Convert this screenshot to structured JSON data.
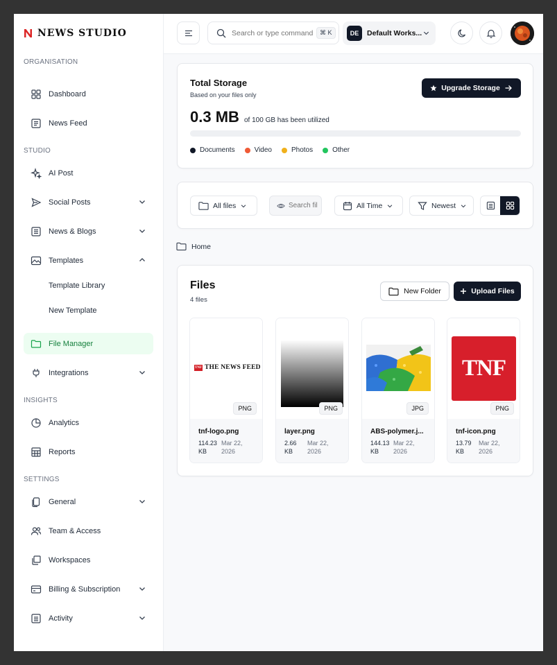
{
  "brand": {
    "name": "NEWS STUDIO",
    "accent": "#dc2626"
  },
  "sidebar": {
    "sections": {
      "organisation": "ORGANISATION",
      "studio": "STUDIO",
      "insights": "INSIGHTS",
      "settings": "SETTINGS"
    },
    "items": {
      "dashboard": "Dashboard",
      "news_feed": "News Feed",
      "ai_post": "AI Post",
      "social_posts": "Social Posts",
      "news_blogs": "News & Blogs",
      "templates": "Templates",
      "template_library": "Template Library",
      "new_template": "New Template",
      "file_manager": "File Manager",
      "integrations": "Integrations",
      "analytics": "Analytics",
      "reports": "Reports",
      "general": "General",
      "team_access": "Team & Access",
      "workspaces": "Workspaces",
      "billing": "Billing & Subscription",
      "activity": "Activity"
    }
  },
  "topbar": {
    "search_placeholder": "Search or type command",
    "shortcut": "⌘ K",
    "workspace_initials": "DE",
    "workspace_name": "Default Works..."
  },
  "storage": {
    "title": "Total Storage",
    "subtitle": "Based on your files only",
    "upgrade_label": "Upgrade Storage",
    "amount": "0.3 MB",
    "note": "of 100 GB has been utilized",
    "used_fraction": 3e-06,
    "legend": [
      {
        "label": "Documents",
        "color": "#111827"
      },
      {
        "label": "Video",
        "color": "#ef5a36"
      },
      {
        "label": "Photos",
        "color": "#f0b01b"
      },
      {
        "label": "Other",
        "color": "#22c55e"
      }
    ]
  },
  "filters": {
    "type": "All files",
    "search_placeholder": "Search files",
    "time": "All Time",
    "sort": "Newest"
  },
  "breadcrumb": {
    "home": "Home"
  },
  "files": {
    "title": "Files",
    "count": "4 files",
    "new_folder_label": "New Folder",
    "upload_label": "Upload Files",
    "items": [
      {
        "name": "tnf-logo.png",
        "size": "114.23 KB",
        "date": "Mar 22, 2026",
        "type": "PNG",
        "logo_mark": "TNF",
        "logo_text": "THE NEWS FEED"
      },
      {
        "name": "layer.png",
        "size": "2.66 KB",
        "date": "Mar 22, 2026",
        "type": "PNG"
      },
      {
        "name": "ABS-polymer.j...",
        "size": "144.13 KB",
        "date": "Mar 22, 2026",
        "type": "JPG"
      },
      {
        "name": "tnf-icon.png",
        "size": "13.79 KB",
        "date": "Mar 22, 2026",
        "type": "PNG",
        "logo_mark": "TNF"
      }
    ]
  }
}
